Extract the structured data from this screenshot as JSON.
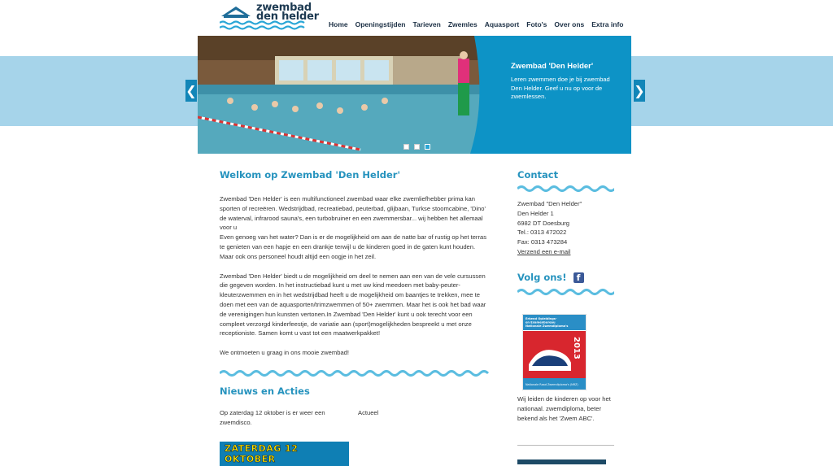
{
  "logo": {
    "line1": "zwembad",
    "line2": "den helder"
  },
  "nav": [
    "Home",
    "Openingstijden",
    "Tarieven",
    "Zwemles",
    "Aquasport",
    "Foto's",
    "Over ons",
    "Extra info"
  ],
  "slider": {
    "title": "Zwembad 'Den Helder'",
    "text": "Leren zwemmen doe je bij zwembad Den Helder. Geef u nu op voor de zwemlessen.",
    "prev": "❮",
    "next": "❯",
    "active_slide": 3,
    "slide_count": 3
  },
  "welcome": {
    "title": "Welkom op Zwembad 'Den Helder'",
    "p1": "Zwembad 'Den Helder' is een multifunctioneel zwembad waar elke zwemliefhebber prima kan sporten of recreëren. Wedstrijdbad, recreatiebad, peuterbad, glijbaan, Turkse stoomcabine, 'Dino' de waterval, infrarood sauna's, een turbobruiner en een zwemmersbar... wij hebben het allemaal voor u",
    "p2": "Even genoeg van het water? Dan is er de mogelijkheid om aan de natte bar of rustig op het terras te genieten van een hapje en een drankje terwijl u de kinderen goed in de gaten kunt houden. Maar ook ons personeel houdt altijd een oogje in het zeil.",
    "p3": "Zwembad 'Den Helder' biedt u de mogelijkheid om deel te nemen aan een van de vele cursussen die gegeven worden. In het instructiebad kunt u met uw kind meedoen met baby-peuter-kleuterzwemmen en in het wedstrijdbad heeft u de mogelijkheid om baantjes te trekken, mee te doen met een van de aquasporten/trimzwemmen of 50+ zwemmen. Maar het is ook het bad waar de verenigingen hun kunsten vertonen.In Zwembad 'Den Helder' kunt u ook terecht voor een compleet verzorgd kinderfeestje, de variatie aan (sport)mogelijkheden bespreekt u met onze receptioniste. Samen komt u vast tot een maatwerkpakket!",
    "p4": "We ontmoeten u graag in ons mooie zwembad!"
  },
  "news": {
    "title": "Nieuws en Acties",
    "item_text": "Op zaterdag 12 oktober is er weer een zwemdisco.",
    "item_category": "Actueel",
    "image_text": "ZATERDAG 12 OKTOBER"
  },
  "contact": {
    "title": "Contact",
    "name": "Zwembad \"Den Helder\"",
    "street": "Den Helder 1",
    "city": "6982 DT Doesburg",
    "tel": "Tel.: 0313 472022",
    "fax": "Fax: 0313 473284",
    "email_link": "Verzend een e-mail"
  },
  "follow": {
    "title": "Volg ons!",
    "facebook_glyph": "f"
  },
  "diploma": {
    "header": "Erkend Opleidings- en Examenbureau Nationale Zwemdiploma's",
    "year": "2013",
    "footer": "Nationale Raad Zwemdiploma's (NRZ)",
    "text": "Wij leiden de kinderen op voor het nationaal. zwemdiploma, beter bekend als het 'Zwem ABC'."
  },
  "colors": {
    "accent": "#2693be",
    "banner": "#0d93c6",
    "band": "#a6d4ea",
    "nav": "#1b2f44"
  }
}
